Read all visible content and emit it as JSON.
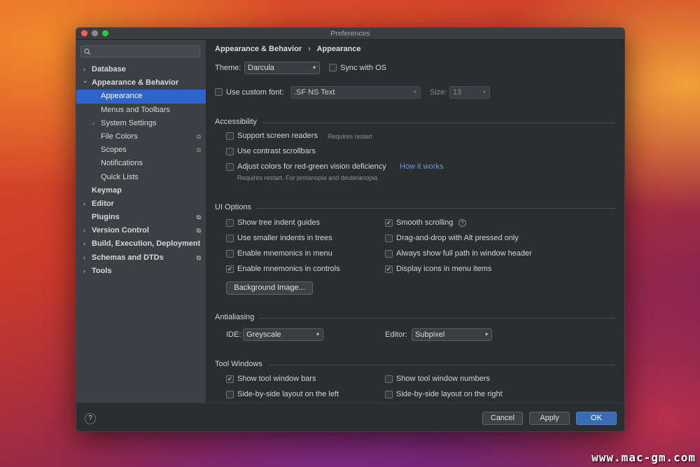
{
  "window": {
    "title": "Preferences"
  },
  "search": {
    "placeholder": ""
  },
  "sidebar": {
    "items": [
      {
        "label": "Database",
        "expander": "›"
      },
      {
        "label": "Appearance & Behavior",
        "expander": "⌄"
      },
      {
        "label": "Appearance"
      },
      {
        "label": "Menus and Toolbars"
      },
      {
        "label": "System Settings",
        "expander": "›"
      },
      {
        "label": "File Colors",
        "badge": "⧉"
      },
      {
        "label": "Scopes",
        "badge": "⧉"
      },
      {
        "label": "Notifications"
      },
      {
        "label": "Quick Lists"
      },
      {
        "label": "Keymap"
      },
      {
        "label": "Editor",
        "expander": "›"
      },
      {
        "label": "Plugins",
        "badge": "⧉"
      },
      {
        "label": "Version Control",
        "expander": "›",
        "badge": "⧉"
      },
      {
        "label": "Build, Execution, Deployment",
        "expander": "›"
      },
      {
        "label": "Schemas and DTDs",
        "expander": "›",
        "badge": "⧉"
      },
      {
        "label": "Tools",
        "expander": "›"
      }
    ]
  },
  "breadcrumb": {
    "parent": "Appearance & Behavior",
    "separator": "›",
    "current": "Appearance"
  },
  "theme": {
    "label": "Theme:",
    "value": "Darcula",
    "sync_label": "Sync with OS",
    "sync_checked": false
  },
  "font": {
    "use_custom_label": "Use custom font:",
    "use_custom_checked": false,
    "value": ".SF NS Text",
    "size_label": "Size:",
    "size_value": "13"
  },
  "accessibility": {
    "title": "Accessibility",
    "screen_readers": {
      "label": "Support screen readers",
      "hint": "Requires restart",
      "checked": false
    },
    "contrast_scrollbars": {
      "label": "Use contrast scrollbars",
      "checked": false
    },
    "red_green": {
      "label": "Adjust colors for red-green vision deficiency",
      "link": "How it works",
      "hint": "Requires restart. For protanopia and deuteranopia",
      "checked": false
    }
  },
  "ui_options": {
    "title": "UI Options",
    "left": [
      {
        "label": "Show tree indent guides",
        "checked": false
      },
      {
        "label": "Use smaller indents in trees",
        "checked": false
      },
      {
        "label": "Enable mnemonics in menu",
        "checked": false
      },
      {
        "label": "Enable mnemonics in controls",
        "checked": true
      }
    ],
    "right": [
      {
        "label": "Smooth scrolling",
        "checked": true
      },
      {
        "label": "Drag-and-drop with Alt pressed only",
        "checked": false
      },
      {
        "label": "Always show full path in window header",
        "checked": false
      },
      {
        "label": "Display icons in menu items",
        "checked": true
      }
    ],
    "background_button": "Background Image..."
  },
  "antialiasing": {
    "title": "Antialiasing",
    "ide_label": "IDE:",
    "ide_value": "Greyscale",
    "editor_label": "Editor:",
    "editor_value": "Subpixel"
  },
  "tool_windows": {
    "title": "Tool Windows",
    "items": [
      {
        "label": "Show tool window bars",
        "checked": true
      },
      {
        "label": "Show tool window numbers",
        "checked": false
      },
      {
        "label": "Side-by-side layout on the left",
        "checked": false
      },
      {
        "label": "Side-by-side layout on the right",
        "checked": false
      }
    ]
  },
  "footer": {
    "help": "?",
    "cancel": "Cancel",
    "apply": "Apply",
    "ok": "OK"
  },
  "symbols": {
    "check": "✓",
    "caret": "▾",
    "question": "?"
  },
  "watermark": "www.mac-gm.com"
}
